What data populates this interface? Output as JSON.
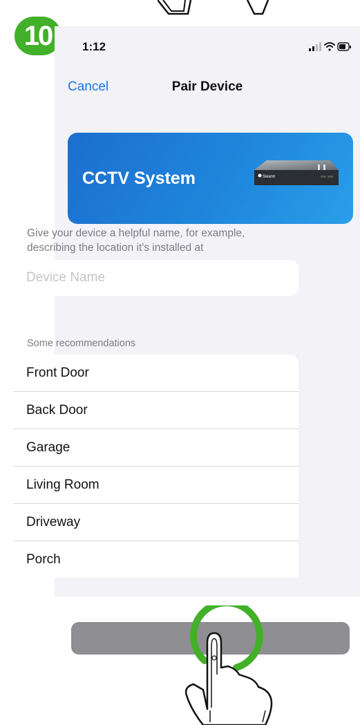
{
  "step": {
    "number": "10"
  },
  "status_bar": {
    "time": "1:12"
  },
  "nav": {
    "cancel": "Cancel",
    "title": "Pair Device"
  },
  "banner": {
    "title": "CCTV System",
    "device_brand": "Swann"
  },
  "device_name": {
    "hint": "Give your device a helpful name, for example, describing the location it's installed at",
    "placeholder": "Device Name",
    "value": ""
  },
  "recommendations": {
    "header": "Some recommendations",
    "items": [
      "Front Door",
      "Back Door",
      "Garage",
      "Living Room",
      "Driveway",
      "Porch"
    ]
  },
  "colors": {
    "accent": "#1a73e8",
    "step_badge": "#43b02a",
    "banner": "#1f86dc",
    "button": "#8e8e93"
  },
  "icons": [
    "signal-icon",
    "wifi-icon",
    "battery-icon",
    "tap-finger-icon"
  ]
}
